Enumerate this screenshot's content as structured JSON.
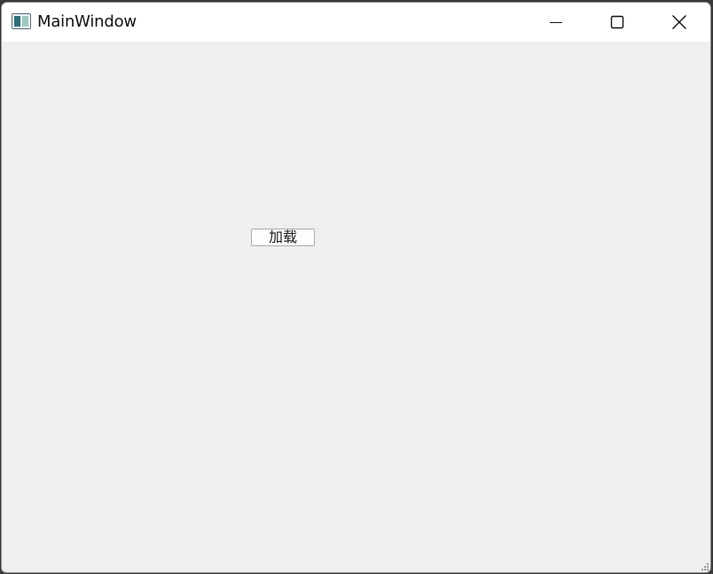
{
  "window": {
    "title": "MainWindow",
    "app_icon": "app-window-icon",
    "controls": {
      "minimize": "minimize-icon",
      "maximize": "maximize-icon",
      "close": "close-icon"
    }
  },
  "main": {
    "load_button_label": "加载"
  },
  "colors": {
    "client_background": "#efefef",
    "titlebar_background": "#ffffff"
  }
}
